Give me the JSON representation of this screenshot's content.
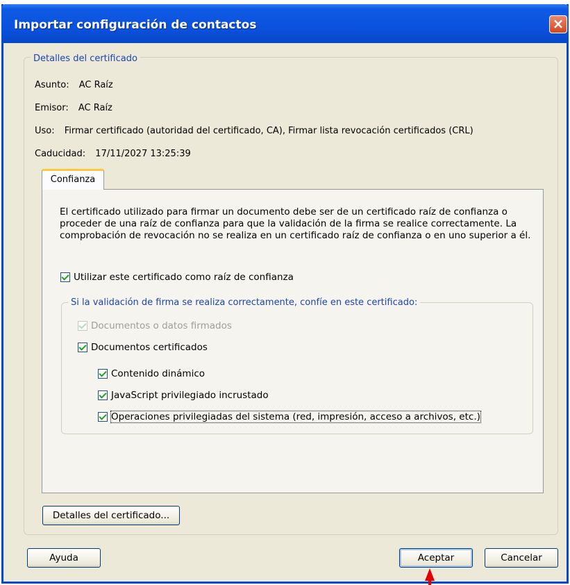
{
  "window": {
    "title": "Importar configuración de contactos",
    "close_glyph": "×"
  },
  "details": {
    "legend": "Detalles del certificado",
    "subject_key": "Asunto:",
    "subject_val": "AC Raíz",
    "issuer_key": "Emisor:",
    "issuer_val": "AC Raíz",
    "usage_key": "Uso:",
    "usage_val": "Firmar certificado (autoridad del certificado, CA), Firmar lista revocación certificados (CRL)",
    "expiry_key": "Caducidad:",
    "expiry_val": "17/11/2027 13:25:39"
  },
  "tab": {
    "label": "Confianza"
  },
  "trust": {
    "paragraph": "El certificado utilizado para firmar un documento debe ser de un certificado raíz de confianza o proceder de una raíz de confianza para que la validación de la firma se realice correctamente. La comprobación de revocación no se realiza en un certificado raíz de confianza o en uno superior a él.",
    "use_as_root": "Utilizar este certificado como raíz de confianza",
    "group_legend": "Si la validación de firma se realiza correctamente, confíe en este certificado:",
    "signed_docs": "Documentos o datos firmados",
    "certified_docs": "Documentos certificados",
    "dynamic_content": "Contenido dinámico",
    "javascript": "JavaScript privilegiado incrustado",
    "system_ops": "Operaciones privilegiadas del sistema (red, impresión, acceso a archivos, etc.)"
  },
  "buttons": {
    "cert_details": "Detalles del certificado...",
    "help": "Ayuda",
    "ok": "Aceptar",
    "cancel": "Cancelar"
  },
  "icons": {
    "checkbox": "checkmark-icon",
    "pointer": "red-arrow-icon"
  },
  "colors": {
    "titlebar": "#0a52de",
    "legend": "#1c45b0",
    "check": "#21a121",
    "arrow": "#e00000"
  }
}
